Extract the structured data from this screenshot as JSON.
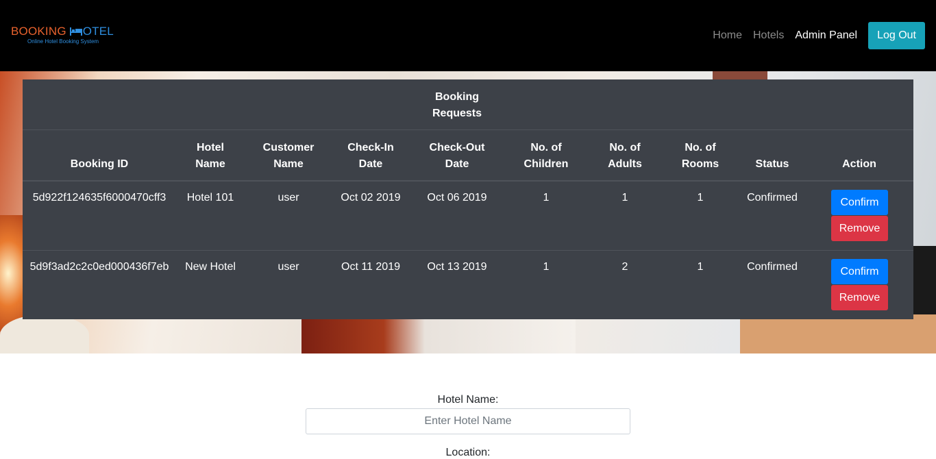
{
  "brand": {
    "name_part1": "BOOKING",
    "name_part2": "OTEL",
    "tagline": "Online Hotel Booking System",
    "color_orange": "#e8622d",
    "color_blue": "#2f8fe0"
  },
  "nav": {
    "home": "Home",
    "hotels": "Hotels",
    "admin": "Admin Panel",
    "logout": "Log Out",
    "logout_color": "#17a2b8"
  },
  "table": {
    "title": "Booking Requests",
    "title_line1": "Booking",
    "title_line2": "Requests",
    "columns": [
      {
        "line1": "",
        "line2": "Booking ID"
      },
      {
        "line1": "Hotel",
        "line2": "Name"
      },
      {
        "line1": "Customer",
        "line2": "Name"
      },
      {
        "line1": "Check-In",
        "line2": "Date"
      },
      {
        "line1": "Check-Out",
        "line2": "Date"
      },
      {
        "line1": "No. of",
        "line2": "Children"
      },
      {
        "line1": "No. of",
        "line2": "Adults"
      },
      {
        "line1": "No. of",
        "line2": "Rooms"
      },
      {
        "line1": "",
        "line2": "Status"
      },
      {
        "line1": "",
        "line2": "Action"
      }
    ],
    "rows": [
      {
        "booking_id": "5d922f124635f6000470cff3",
        "hotel": "Hotel 101",
        "customer": "user",
        "check_in": "Oct 02 2019",
        "check_out": "Oct 06 2019",
        "children": "1",
        "adults": "1",
        "rooms": "1",
        "status": "Confirmed",
        "confirm_label": "Confirm",
        "remove_label": "Remove"
      },
      {
        "booking_id": "5d9f3ad2c2c0ed000436f7eb",
        "hotel": "New Hotel",
        "customer": "user",
        "check_in": "Oct 11 2019",
        "check_out": "Oct 13 2019",
        "children": "1",
        "adults": "2",
        "rooms": "1",
        "status": "Confirmed",
        "confirm_label": "Confirm",
        "remove_label": "Remove"
      }
    ]
  },
  "form": {
    "hotel_name_label": "Hotel Name:",
    "hotel_name_placeholder": "Enter Hotel Name",
    "location_label": "Location:"
  }
}
